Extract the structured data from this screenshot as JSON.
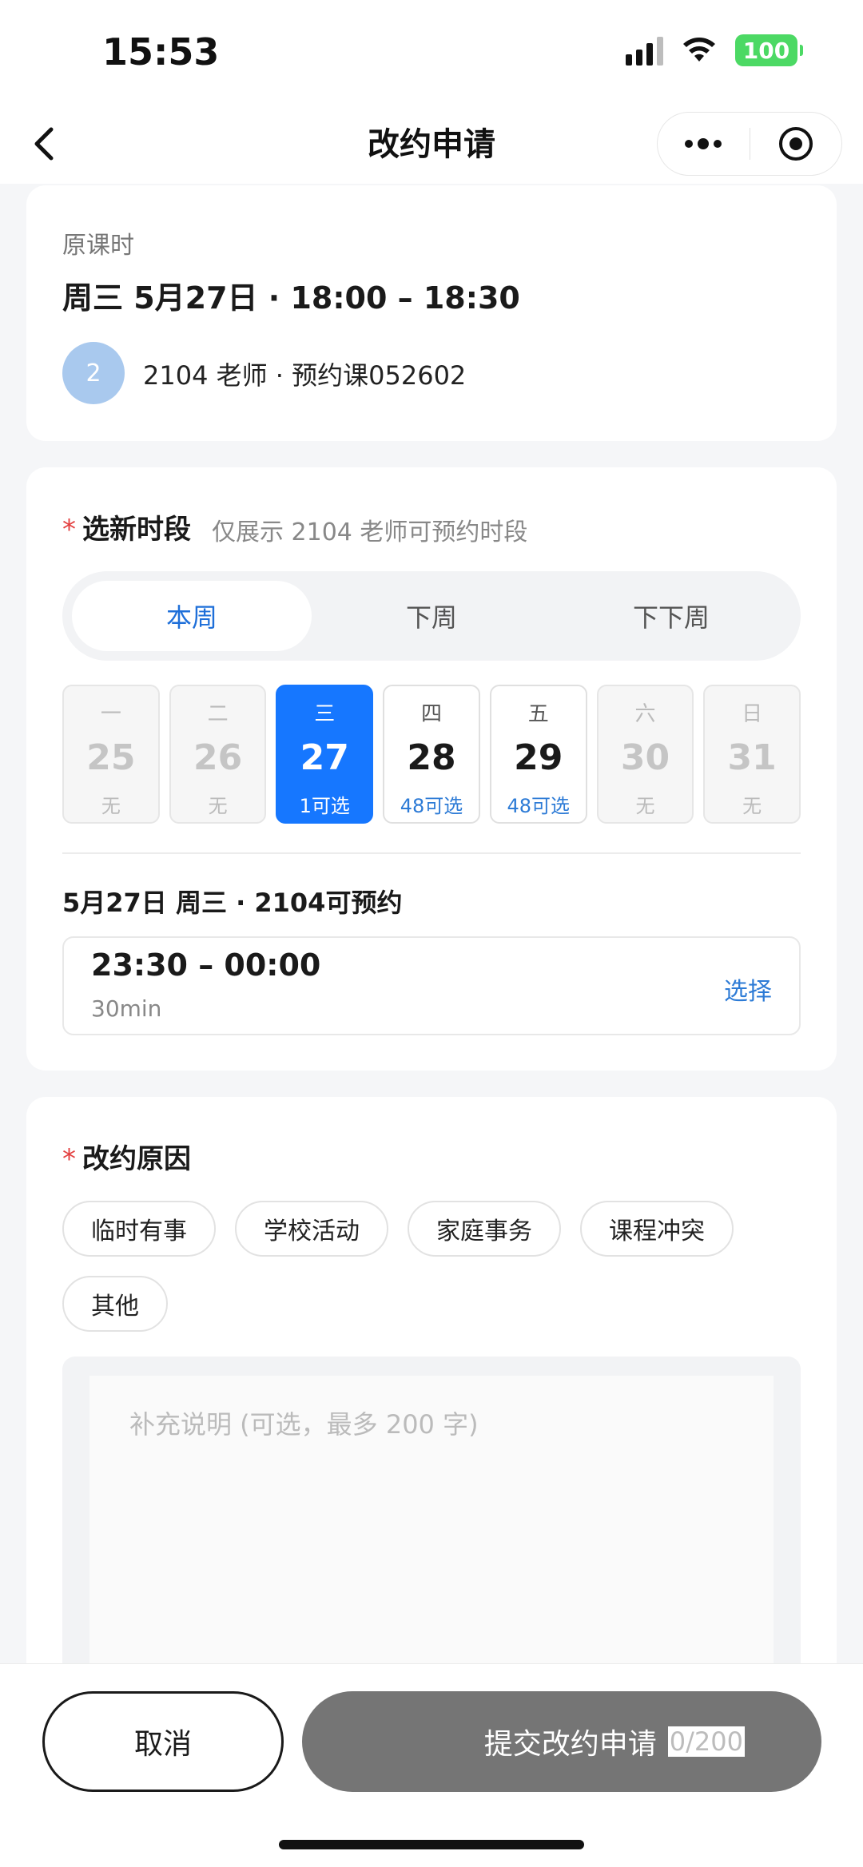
{
  "status_bar": {
    "time": "15:53",
    "battery": "100"
  },
  "nav": {
    "title": "改约申请"
  },
  "original_lesson": {
    "label": "原课时",
    "datetime": "周三 5月27日 · 18:00 – 18:30",
    "avatar_text": "2",
    "teacher_line": "2104 老师 · 预约课052602"
  },
  "slot_section": {
    "required_mark": "*",
    "title": "选新时段",
    "hint": "仅展示 2104 老师可预约时段",
    "week_tabs": [
      {
        "label": "本周",
        "active": true
      },
      {
        "label": "下周",
        "active": false
      },
      {
        "label": "下下周",
        "active": false
      }
    ],
    "days": [
      {
        "dow": "一",
        "num": "25",
        "avail": "无",
        "state": "disabled"
      },
      {
        "dow": "二",
        "num": "26",
        "avail": "无",
        "state": "disabled"
      },
      {
        "dow": "三",
        "num": "27",
        "avail": "1可选",
        "state": "selected"
      },
      {
        "dow": "四",
        "num": "28",
        "avail": "48可选",
        "state": "open"
      },
      {
        "dow": "五",
        "num": "29",
        "avail": "48可选",
        "state": "open"
      },
      {
        "dow": "六",
        "num": "30",
        "avail": "无",
        "state": "disabled"
      },
      {
        "dow": "日",
        "num": "31",
        "avail": "无",
        "state": "disabled"
      }
    ],
    "selected_date_label": "5月27日 周三 · 2104可预约",
    "slot": {
      "time": "23:30 – 00:00",
      "duration": "30min",
      "action": "选择"
    }
  },
  "reason_section": {
    "required_mark": "*",
    "title": "改约原因",
    "chips": [
      "临时有事",
      "学校活动",
      "家庭事务",
      "课程冲突",
      "其他"
    ],
    "textarea_value": "",
    "textarea_placeholder": "补充说明 (可选，最多 200 字)"
  },
  "bottom": {
    "cancel_label": "取消",
    "submit_label": "提交改约申请",
    "counter": "0/200"
  },
  "colors": {
    "accent": "#1677ff",
    "link": "#2d7bd6",
    "required": "#e34040",
    "submit_disabled": "#757575",
    "battery": "#4cd964"
  }
}
